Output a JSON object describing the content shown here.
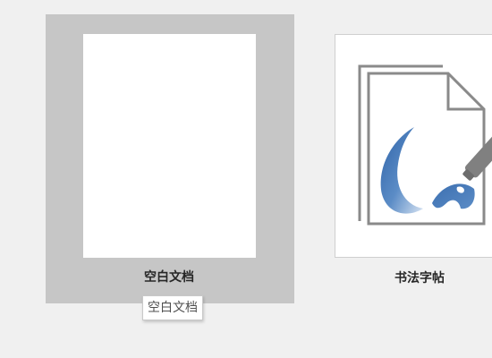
{
  "templates": [
    {
      "label": "空白文档",
      "state": "hover"
    },
    {
      "label": "书法字帖",
      "icon": "calligraphy-brush-icon"
    }
  ],
  "tooltip": {
    "text": "空白文档"
  },
  "colors": {
    "background": "#f0f0f0",
    "hover_highlight": "#c6c6c6",
    "brush_accent": "#4a7db8"
  }
}
